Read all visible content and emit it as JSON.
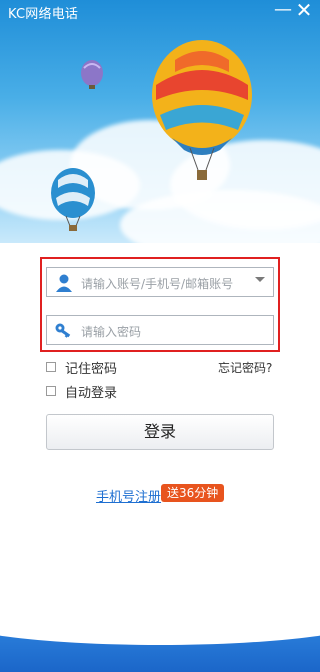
{
  "app": {
    "title": "KC网络电话"
  },
  "window_controls": {
    "minimize": "—",
    "close": "✕"
  },
  "login": {
    "account_placeholder": "请输入账号/手机号/邮箱账号",
    "password_placeholder": "请输入密码",
    "remember_label": "记住密码",
    "auto_login_label": "自动登录",
    "forgot_label": "忘记密码?",
    "login_button": "登录"
  },
  "footer_links": {
    "register": "手机号注册",
    "promo": "送36分钟"
  },
  "colors": {
    "accent": "#1e6fd1",
    "highlight": "#e02020",
    "promo": "#e8541e"
  }
}
